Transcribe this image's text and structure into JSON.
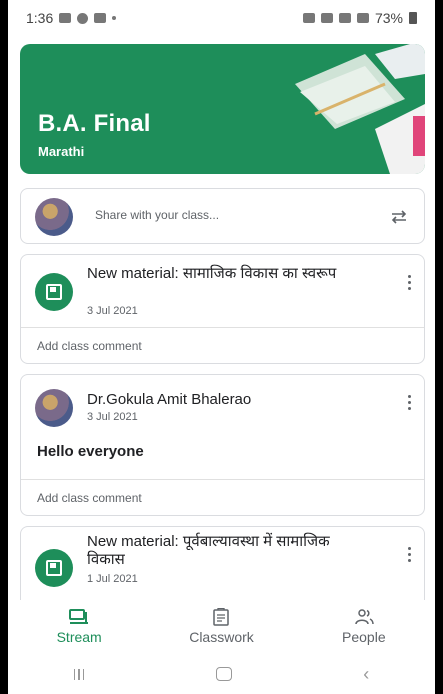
{
  "status_bar": {
    "time": "1:36",
    "battery": "73%"
  },
  "banner": {
    "title": "B.A. Final",
    "subtitle": "Marathi",
    "color": "#1e8e5a"
  },
  "share": {
    "placeholder": "Share with your class..."
  },
  "posts": [
    {
      "type": "material",
      "title": "New material: सामाजिक विकास का स्वरूप",
      "date": "3 Jul 2021",
      "comment_label": "Add class comment"
    },
    {
      "type": "announcement",
      "author": "Dr.Gokula Amit Bhalerao",
      "date": "3 Jul 2021",
      "body": "Hello everyone",
      "comment_label": "Add class comment"
    },
    {
      "type": "material",
      "title": "New material: पूर्वबाल्यावस्था में सामाजिक विकास",
      "date": "1 Jul 2021"
    }
  ],
  "bottom_nav": {
    "items": [
      {
        "label": "Stream",
        "icon": "stream-icon",
        "active": true
      },
      {
        "label": "Classwork",
        "icon": "classwork-icon",
        "active": false
      },
      {
        "label": "People",
        "icon": "people-icon",
        "active": false
      }
    ]
  },
  "colors": {
    "accent": "#1e8e5a"
  }
}
